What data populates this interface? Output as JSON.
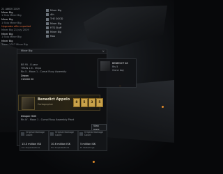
{
  "notifications": [
    {
      "date": "21 AWDV 2019",
      "title": "Miner Big",
      "body": "1 Ship Miner Big"
    },
    {
      "date": "",
      "title": "Miner Big",
      "body": "1 Ship Miner Big"
    },
    {
      "date": "",
      "title": "Upgrades offer reported",
      "body": "Miner Big 21 July 2019",
      "warn": true
    },
    {
      "date": "",
      "title": "Miner Big",
      "body": "1 Ship Miner Big"
    },
    {
      "date": "",
      "title": "Miner Big",
      "body": "Tower 2017 Miner Big"
    }
  ],
  "sidelist": [
    "Miner Big",
    "4th",
    "THE GOOD",
    "Miner Big",
    "FITS Stuff",
    "Miner Big",
    "Moo"
  ],
  "panel": {
    "title": "Miner Big",
    "rows": [
      {
        "label": "BB 95 - 8 year",
        "value": "BENEDICT 48"
      },
      {
        "label": "TRAIN 1.6 - Ships",
        "value": "1 SHIP"
      },
      {
        "label": "Ris 5 - Moon 1 - Cumal Ruuy Assembly",
        "value": ""
      },
      {
        "label": "Drawn",
        "value": "ANE 1 10"
      },
      {
        "label": "110040 20",
        "value": ""
      }
    ],
    "right_header": "BENEDICT 48",
    "right_sub": "Ris 5",
    "right_note": "Clone bay"
  },
  "pilot": {
    "name": "Benedict Appolo",
    "status": "Cartographer",
    "slots": [
      "8",
      "5",
      "3",
      "5"
    ]
  },
  "location": {
    "line1": "Deagon ISDS",
    "line2": "Ris IV - Moon 1 - Cumal Ruuy Assembly Plant"
  },
  "view_more": "View more",
  "stats": [
    {
      "head": "Original Damage Count",
      "value": "13.3 million ISK",
      "note": "For Dupedestions"
    },
    {
      "head": "Original Damage Count",
      "value": "10.6 million ISK",
      "note": "For Dupedestions"
    },
    {
      "head": "Original Damage Count",
      "value": "5 million ISK",
      "note": "Pr Vesterlings"
    }
  ]
}
